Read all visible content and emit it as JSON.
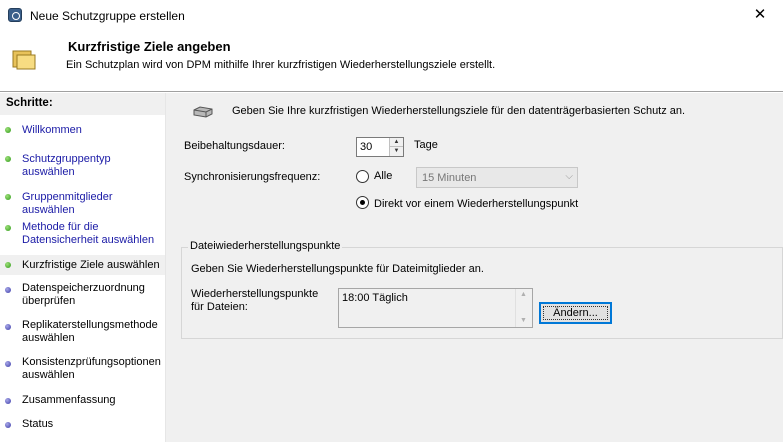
{
  "window": {
    "title": "Neue Schutzgruppe erstellen",
    "close_glyph": "✕",
    "icon": "dpm-app-icon"
  },
  "header": {
    "title": "Kurzfristige Ziele angeben",
    "subtitle": "Ein Schutzplan wird von DPM mithilfe Ihrer kurzfristigen Wiederherstellungsziele erstellt.",
    "icon": "folder-icon"
  },
  "steps": {
    "heading": "Schritte:",
    "items": [
      {
        "label": "Willkommen",
        "state": "done"
      },
      {
        "label": "Schutzgruppentyp auswählen",
        "state": "done"
      },
      {
        "label": "Gruppenmitglieder auswählen",
        "state": "done"
      },
      {
        "label": "Methode für die Datensicherheit auswählen",
        "state": "done"
      },
      {
        "label": "Kurzfristige Ziele auswählen",
        "state": "current"
      },
      {
        "label": "Datenspeicherzuordnung überprüfen",
        "state": "pending"
      },
      {
        "label": "Replikaterstellungsmethode auswählen",
        "state": "pending"
      },
      {
        "label": "Konsistenzprüfungsoptionen auswählen",
        "state": "pending"
      },
      {
        "label": "Zusammenfassung",
        "state": "pending"
      },
      {
        "label": "Status",
        "state": "pending"
      }
    ]
  },
  "main": {
    "intro": "Geben Sie Ihre kurzfristigen Wiederherstellungsziele für den datenträgerbasierten Schutz an.",
    "retention": {
      "label": "Beibehaltungsdauer:",
      "value": "30",
      "unit": "Tage"
    },
    "sync": {
      "label": "Synchronisierungsfrequenz:",
      "option_all": "Alle",
      "frequency_value": "15 Minuten",
      "option_before": "Direkt vor einem Wiederherstellungspunkt",
      "selected": "before"
    },
    "file_recovery": {
      "title": "Dateiwiederherstellungspunkte",
      "description": "Geben Sie Wiederherstellungspunkte für Dateimitglieder an.",
      "label_line1": "Wiederherstellungspunkte",
      "label_line2": "für Dateien:",
      "schedule": "18:00 Täglich",
      "change_button": "Ändern..."
    }
  },
  "colors": {
    "link": "#1a1aa6",
    "focus": "#0078d7",
    "panel": "#f0f0f0"
  }
}
